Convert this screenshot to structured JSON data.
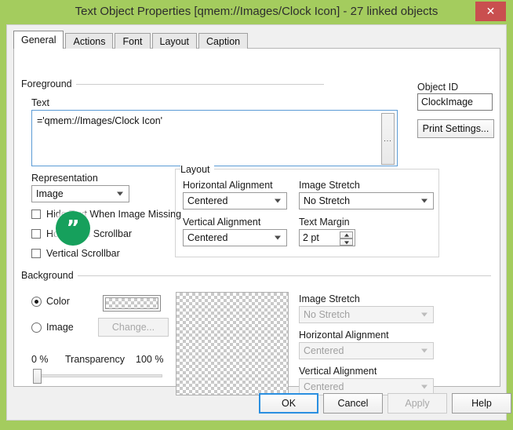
{
  "window": {
    "title": "Text Object Properties [qmem://Images/Clock Icon] - 27 linked objects",
    "close_label": "✕",
    "frame_color": "#a4cc5e",
    "close_color": "#c94f4f"
  },
  "tabs": [
    {
      "label": "General",
      "active": true
    },
    {
      "label": "Actions",
      "active": false
    },
    {
      "label": "Font",
      "active": false
    },
    {
      "label": "Layout",
      "active": false
    },
    {
      "label": "Caption",
      "active": false
    }
  ],
  "foreground": {
    "group_label": "Foreground",
    "text_label": "Text",
    "text_value": "='qmem://Images/Clock Icon'",
    "ellipsis_label": "...",
    "representation_label": "Representation",
    "representation_value": "Image",
    "checkboxes": [
      {
        "label": "Hide Text When Image Missing",
        "checked": false
      },
      {
        "label": "Horizontal Scrollbar",
        "checked": false
      },
      {
        "label": "Vertical Scrollbar",
        "checked": false
      }
    ]
  },
  "object_panel": {
    "object_id_label": "Object ID",
    "object_id_value": "ClockImage",
    "print_settings_label": "Print Settings..."
  },
  "layout_group": {
    "group_label": "Layout",
    "horizontal_alignment_label": "Horizontal Alignment",
    "horizontal_alignment_value": "Centered",
    "vertical_alignment_label": "Vertical Alignment",
    "vertical_alignment_value": "Centered",
    "image_stretch_label": "Image Stretch",
    "image_stretch_value": "No Stretch",
    "text_margin_label": "Text Margin",
    "text_margin_value": "2 pt"
  },
  "background": {
    "group_label": "Background",
    "color_radio_label": "Color",
    "image_radio_label": "Image",
    "color_selected": true,
    "change_button_label": "Change...",
    "transparency_label": "Transparency",
    "transparency_min_label": "0 %",
    "transparency_max_label": "100 %",
    "transparency_value": 0,
    "image_stretch_label": "Image Stretch",
    "image_stretch_value": "No Stretch",
    "horizontal_alignment_label": "Horizontal Alignment",
    "horizontal_alignment_value": "Centered",
    "vertical_alignment_label": "Vertical Alignment",
    "vertical_alignment_value": "Centered"
  },
  "buttons": {
    "ok": "OK",
    "cancel": "Cancel",
    "apply": "Apply",
    "help": "Help"
  },
  "overlay_badge": {
    "glyph": "”",
    "color": "#16a05c"
  }
}
